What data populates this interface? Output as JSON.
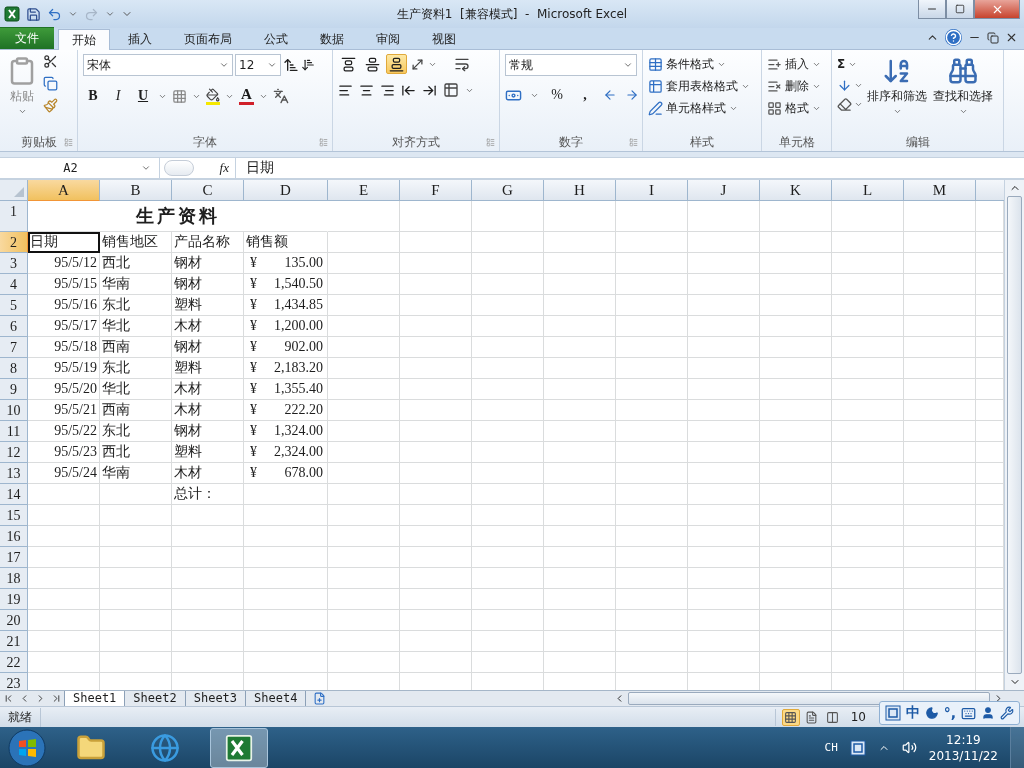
{
  "title_bar": {
    "title": "生产资料1  [兼容模式]  -  Microsoft Excel"
  },
  "ribbon_tabs": [
    {
      "label": "文件",
      "kind": "file",
      "selected": false
    },
    {
      "label": "开始",
      "kind": "tab",
      "selected": true
    },
    {
      "label": "插入",
      "kind": "tab",
      "selected": false
    },
    {
      "label": "页面布局",
      "kind": "tab",
      "selected": false
    },
    {
      "label": "公式",
      "kind": "tab",
      "selected": false
    },
    {
      "label": "数据",
      "kind": "tab",
      "selected": false
    },
    {
      "label": "审阅",
      "kind": "tab",
      "selected": false
    },
    {
      "label": "视图",
      "kind": "tab",
      "selected": false
    }
  ],
  "ribbon": {
    "clipboard": {
      "paste": "粘贴",
      "label": "剪贴板"
    },
    "font": {
      "name": "宋体",
      "size": "12",
      "bold": "B",
      "italic": "I",
      "underline": "U",
      "font_color": "A",
      "label": "字体"
    },
    "alignment": {
      "vertical": [
        {
          "kind": "top",
          "selected": false
        },
        {
          "kind": "middle",
          "selected": false
        },
        {
          "kind": "bottom",
          "selected": true
        }
      ],
      "label": "对齐方式"
    },
    "number": {
      "format": "常规",
      "percent": "%",
      "comma": ",",
      "label": "数字"
    },
    "styles": {
      "items": [
        "条件格式",
        "套用表格格式",
        "单元格样式"
      ],
      "label": "样式"
    },
    "cells": {
      "items": [
        "插入",
        "删除",
        "格式"
      ],
      "label": "单元格"
    },
    "editing": {
      "sum": "Σ",
      "sort": "排序和筛选",
      "find": "查找和选择",
      "label": "编辑"
    }
  },
  "formula_bar": {
    "name_box": "A2",
    "fx": "fx",
    "value": "日期"
  },
  "sheet": {
    "columns": [
      {
        "label": "A",
        "selected": true
      },
      {
        "label": "B",
        "selected": false
      },
      {
        "label": "C",
        "selected": false
      },
      {
        "label": "D",
        "selected": false
      },
      {
        "label": "E",
        "selected": false
      },
      {
        "label": "F",
        "selected": false
      },
      {
        "label": "G",
        "selected": false
      },
      {
        "label": "H",
        "selected": false
      },
      {
        "label": "I",
        "selected": false
      },
      {
        "label": "J",
        "selected": false
      },
      {
        "label": "K",
        "selected": false
      },
      {
        "label": "L",
        "selected": false
      },
      {
        "label": "M",
        "selected": false
      }
    ],
    "rows": [
      {
        "label": "1",
        "selected": false,
        "kind": "title",
        "text": "生产资料"
      },
      {
        "label": "2",
        "selected": true,
        "kind": "header",
        "cells": [
          "日期",
          "销售地区",
          "产品名称",
          "销售额"
        ]
      },
      {
        "label": "3",
        "selected": false,
        "kind": "record",
        "date": "95/5/12",
        "region": "西北",
        "product": "钢材",
        "currency": "¥",
        "amount": "135.00"
      },
      {
        "label": "4",
        "selected": false,
        "kind": "record",
        "date": "95/5/15",
        "region": "华南",
        "product": "钢材",
        "currency": "¥",
        "amount": "1,540.50"
      },
      {
        "label": "5",
        "selected": false,
        "kind": "record",
        "date": "95/5/16",
        "region": "东北",
        "product": "塑料",
        "currency": "¥",
        "amount": "1,434.85"
      },
      {
        "label": "6",
        "selected": false,
        "kind": "record",
        "date": "95/5/17",
        "region": "华北",
        "product": "木材",
        "currency": "¥",
        "amount": "1,200.00"
      },
      {
        "label": "7",
        "selected": false,
        "kind": "record",
        "date": "95/5/18",
        "region": "西南",
        "product": "钢材",
        "currency": "¥",
        "amount": "902.00"
      },
      {
        "label": "8",
        "selected": false,
        "kind": "record",
        "date": "95/5/19",
        "region": "东北",
        "product": "塑料",
        "currency": "¥",
        "amount": "2,183.20"
      },
      {
        "label": "9",
        "selected": false,
        "kind": "record",
        "date": "95/5/20",
        "region": "华北",
        "product": "木材",
        "currency": "¥",
        "amount": "1,355.40"
      },
      {
        "label": "10",
        "selected": false,
        "kind": "record",
        "date": "95/5/21",
        "region": "西南",
        "product": "木材",
        "currency": "¥",
        "amount": "222.20"
      },
      {
        "label": "11",
        "selected": false,
        "kind": "record",
        "date": "95/5/22",
        "region": "东北",
        "product": "钢材",
        "currency": "¥",
        "amount": "1,324.00"
      },
      {
        "label": "12",
        "selected": false,
        "kind": "record",
        "date": "95/5/23",
        "region": "西北",
        "product": "塑料",
        "currency": "¥",
        "amount": "2,324.00"
      },
      {
        "label": "13",
        "selected": false,
        "kind": "record",
        "date": "95/5/24",
        "region": "华南",
        "product": "木材",
        "currency": "¥",
        "amount": "678.00"
      },
      {
        "label": "14",
        "selected": false,
        "kind": "total",
        "text": "总计："
      },
      {
        "label": "15",
        "selected": false,
        "kind": "empty"
      },
      {
        "label": "16",
        "selected": false,
        "kind": "empty"
      },
      {
        "label": "17",
        "selected": false,
        "kind": "empty"
      },
      {
        "label": "18",
        "selected": false,
        "kind": "empty"
      },
      {
        "label": "19",
        "selected": false,
        "kind": "empty"
      },
      {
        "label": "20",
        "selected": false,
        "kind": "empty"
      },
      {
        "label": "21",
        "selected": false,
        "kind": "empty"
      },
      {
        "label": "22",
        "selected": false,
        "kind": "empty"
      },
      {
        "label": "23",
        "selected": false,
        "kind": "empty"
      }
    ]
  },
  "sheet_tabs": [
    {
      "label": "Sheet1",
      "selected": true
    },
    {
      "label": "Sheet2",
      "selected": false
    },
    {
      "label": "Sheet3",
      "selected": false
    },
    {
      "label": "Sheet4",
      "selected": false
    }
  ],
  "status_bar": {
    "status": "就绪",
    "views": [
      {
        "kind": "normal",
        "selected": true
      },
      {
        "kind": "layout",
        "selected": false
      },
      {
        "kind": "break",
        "selected": false
      }
    ],
    "zoom": "10"
  },
  "ime_bar": {
    "mode": "中",
    "punctuation": "°,"
  },
  "taskbar": {
    "apps": [
      {
        "kind": "explorer",
        "selected": false
      },
      {
        "kind": "browser",
        "selected": false
      },
      {
        "kind": "excel",
        "selected": true
      }
    ],
    "language": "CH",
    "time": "12:19",
    "date": "2013/11/22"
  }
}
